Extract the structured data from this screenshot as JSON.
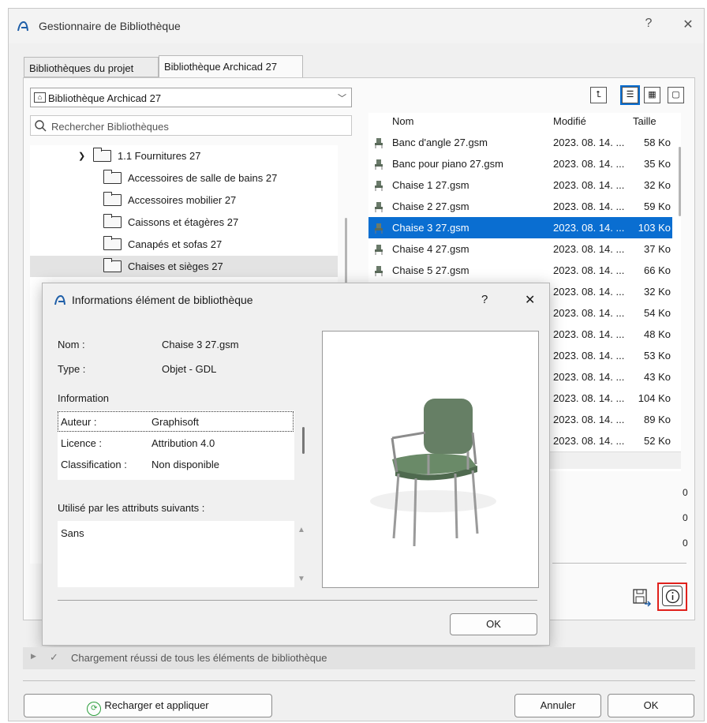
{
  "window": {
    "title": "Gestionnaire de Bibliothèque",
    "help": "?",
    "close": "✕"
  },
  "tabs": [
    {
      "label": "Bibliothèques du projet"
    },
    {
      "label": "Bibliothèque Archicad 27"
    }
  ],
  "library_combo": {
    "value": "Bibliothèque Archicad 27"
  },
  "search": {
    "placeholder": "Rechercher Bibliothèques"
  },
  "tree": {
    "parent": "1.1 Fournitures 27",
    "items": [
      {
        "label": "Accessoires de salle de bains 27"
      },
      {
        "label": "Accessoires mobilier 27"
      },
      {
        "label": "Caissons et étagères 27"
      },
      {
        "label": "Canapés et sofas 27"
      },
      {
        "label": "Chaises et sièges 27"
      }
    ]
  },
  "file_list": {
    "headers": {
      "name": "Nom",
      "modified": "Modifié",
      "size": "Taille"
    },
    "rows": [
      {
        "name": "Banc d'angle 27.gsm",
        "modified": "2023. 08. 14. ...",
        "size": "58 Ko"
      },
      {
        "name": "Banc pour piano 27.gsm",
        "modified": "2023. 08. 14. ...",
        "size": "35 Ko"
      },
      {
        "name": "Chaise 1 27.gsm",
        "modified": "2023. 08. 14. ...",
        "size": "32 Ko"
      },
      {
        "name": "Chaise 2 27.gsm",
        "modified": "2023. 08. 14. ...",
        "size": "59 Ko"
      },
      {
        "name": "Chaise 3 27.gsm",
        "modified": "2023. 08. 14. ...",
        "size": "103 Ko"
      },
      {
        "name": "Chaise 4 27.gsm",
        "modified": "2023. 08. 14. ...",
        "size": "37 Ko"
      },
      {
        "name": "Chaise 5 27.gsm",
        "modified": "2023. 08. 14. ...",
        "size": "66 Ko"
      },
      {
        "name": "",
        "modified": "2023. 08. 14. ...",
        "size": "32 Ko"
      },
      {
        "name": "",
        "modified": "2023. 08. 14. ...",
        "size": "54 Ko"
      },
      {
        "name": "",
        "modified": "2023. 08. 14. ...",
        "size": "48 Ko"
      },
      {
        "name": "",
        "modified": "2023. 08. 14. ...",
        "size": "53 Ko"
      },
      {
        "name": "",
        "modified": "2023. 08. 14. ...",
        "size": "43 Ko"
      },
      {
        "name": "",
        "modified": "2023. 08. 14. ...",
        "size": "104 Ko"
      },
      {
        "name": "",
        "modified": "2023. 08. 14. ...",
        "size": "89 Ko"
      },
      {
        "name": "",
        "modified": "2023. 08. 14. ...",
        "size": "52 Ko"
      }
    ]
  },
  "right_counts": [
    "0",
    "0",
    "0"
  ],
  "info_dialog": {
    "title": "Informations élément de bibliothèque",
    "help": "?",
    "close": "✕",
    "name_label": "Nom :",
    "name_value": "Chaise 3 27.gsm",
    "type_label": "Type :",
    "type_value": "Objet - GDL",
    "information_header": "Information",
    "info_rows": [
      {
        "key": "Auteur :",
        "value": "Graphisoft"
      },
      {
        "key": "Licence :",
        "value": "Attribution 4.0"
      },
      {
        "key": "Classification :",
        "value": "Non disponible"
      }
    ],
    "used_by_label": "Utilisé par les attributs suivants :",
    "used_by_value": "Sans",
    "ok": "OK"
  },
  "status": {
    "text": "Chargement réussi de tous les éléments de bibliothèque"
  },
  "footer": {
    "reload": "Recharger et appliquer",
    "cancel": "Annuler",
    "ok": "OK"
  },
  "colors": {
    "selection": "#0a6ed1",
    "highlight_box": "#e0201b",
    "reload_icon": "#2a9d3a"
  }
}
